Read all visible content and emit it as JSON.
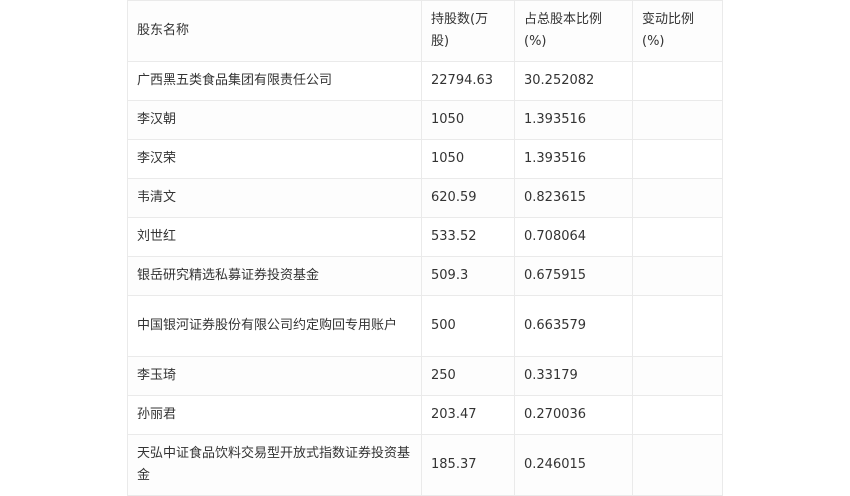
{
  "table": {
    "headers": [
      "股东名称",
      "持股数(万股)",
      "占总股本比例(%)",
      "变动比例(%)"
    ],
    "rows": [
      [
        "广西黑五类食品集团有限责任公司",
        "22794.63",
        "30.252082",
        ""
      ],
      [
        "李汉朝",
        "1050",
        "1.393516",
        ""
      ],
      [
        "李汉荣",
        "1050",
        "1.393516",
        ""
      ],
      [
        "韦清文",
        "620.59",
        "0.823615",
        ""
      ],
      [
        "刘世红",
        "533.52",
        "0.708064",
        ""
      ],
      [
        "银岳研究精选私募证券投资基金",
        "509.3",
        "0.675915",
        ""
      ],
      [
        "中国银河证券股份有限公司约定购回专用账户",
        "500",
        "0.663579",
        ""
      ],
      [
        "李玉琦",
        "250",
        "0.33179",
        ""
      ],
      [
        "孙丽君",
        "203.47",
        "0.270036",
        ""
      ],
      [
        "天弘中证食品饮料交易型开放式指数证券投资基金",
        "185.37",
        "0.246015",
        ""
      ]
    ]
  }
}
